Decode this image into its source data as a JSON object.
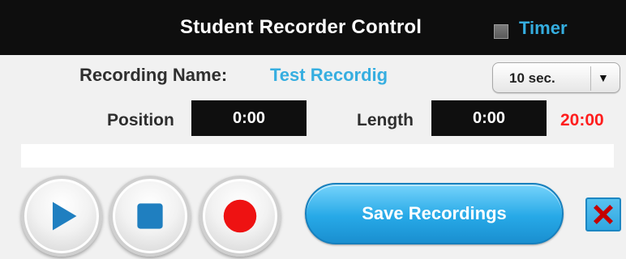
{
  "header": {
    "title": "Student Recorder Control",
    "timer_label": "Timer",
    "timer_checked": false
  },
  "recording": {
    "name_label": "Recording Name:",
    "name_value": "Test Recordig"
  },
  "duration_select": {
    "selected": "10 sec."
  },
  "counters": {
    "position_label": "Position",
    "position_value": "0:00",
    "length_label": "Length",
    "length_value": "0:00",
    "limit_value": "20:00"
  },
  "progress": {
    "fraction": 0
  },
  "controls": {
    "save_label": "Save Recordings",
    "play_icon": "play-icon",
    "stop_icon": "stop-icon",
    "record_icon": "record-icon",
    "close_icon": "close-icon"
  },
  "colors": {
    "accent_blue": "#36aee0",
    "record_red": "#ff1e1e",
    "header_bg": "#0e0e0e"
  }
}
